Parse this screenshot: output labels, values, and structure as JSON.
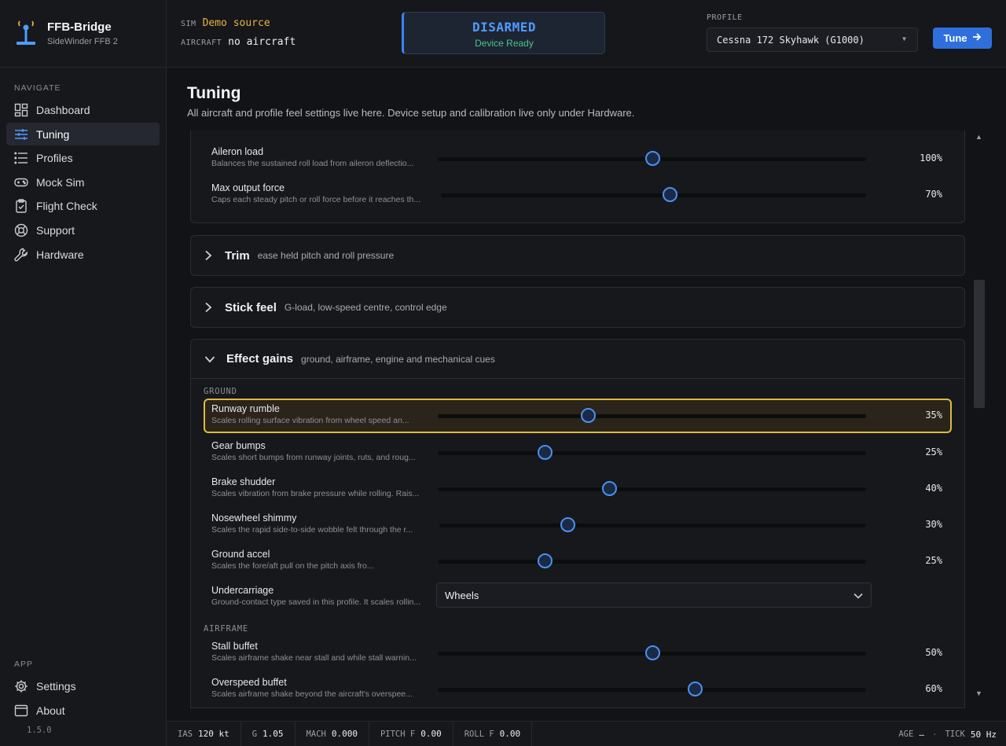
{
  "brand": {
    "title": "FFB-Bridge",
    "subtitle": "SideWinder FFB 2"
  },
  "nav": {
    "section_label": "NAVIGATE",
    "items": [
      {
        "label": "Dashboard",
        "icon": "dashboard-icon"
      },
      {
        "label": "Tuning",
        "icon": "sliders-icon",
        "active": true
      },
      {
        "label": "Profiles",
        "icon": "list-icon"
      },
      {
        "label": "Mock Sim",
        "icon": "gamepad-icon"
      },
      {
        "label": "Flight Check",
        "icon": "clipboard-check-icon"
      },
      {
        "label": "Support",
        "icon": "lifebuoy-icon"
      },
      {
        "label": "Hardware",
        "icon": "wrench-icon"
      }
    ],
    "app_label": "APP",
    "app_items": [
      {
        "label": "Settings",
        "icon": "gear-icon"
      },
      {
        "label": "About",
        "icon": "window-icon"
      }
    ],
    "version": "1.5.0"
  },
  "header": {
    "sim_key": "SIM",
    "sim_value": "Demo source",
    "aircraft_key": "AIRCRAFT",
    "aircraft_value": "no aircraft",
    "status_main": "DISARMED",
    "status_sub": "Device Ready",
    "profile_label": "PROFILE",
    "profile_value": "Cessna 172 Skyhawk (G1000)",
    "tune_label": "Tune"
  },
  "page": {
    "title": "Tuning",
    "subtitle": "All aircraft and profile feel settings live here. Device setup and calibration live only under Hardware."
  },
  "top_panel": {
    "rows": [
      {
        "title": "Aileron load",
        "desc": "Balances the sustained roll load from aileron deflectio...",
        "value": 100,
        "label": "100%"
      },
      {
        "title": "Max output force",
        "desc": "Caps each steady pitch or roll force before it reaches th...",
        "value": 70,
        "label": "70%"
      }
    ]
  },
  "trim": {
    "title": "Trim",
    "desc": "ease held pitch and roll pressure"
  },
  "stick_feel": {
    "title": "Stick feel",
    "desc": "G-load, low-speed centre, control edge"
  },
  "effect_gains": {
    "title": "Effect gains",
    "desc": "ground, airframe, engine and mechanical cues",
    "ground_label": "GROUND",
    "ground_rows": [
      {
        "title": "Runway rumble",
        "desc": "Scales rolling surface vibration from wheel speed an...",
        "value": 35,
        "label": "35%"
      },
      {
        "title": "Gear bumps",
        "desc": "Scales short bumps from runway joints, ruts, and roug...",
        "value": 25,
        "label": "25%"
      },
      {
        "title": "Brake shudder",
        "desc": "Scales vibration from brake pressure while rolling. Rais...",
        "value": 40,
        "label": "40%"
      },
      {
        "title": "Nosewheel shimmy",
        "desc": "Scales the rapid side-to-side wobble felt through the r...",
        "value": 30,
        "label": "30%"
      },
      {
        "title": "Ground accel",
        "desc": "Scales the fore/aft pull on the pitch axis fro...",
        "value": 25,
        "label": "25%"
      }
    ],
    "undercarriage": {
      "title": "Undercarriage",
      "desc": "Ground-contact type saved in this profile. It scales rollin...",
      "value": "Wheels"
    },
    "airframe_label": "AIRFRAME",
    "airframe_rows": [
      {
        "title": "Stall buffet",
        "desc": "Scales airframe shake near stall and while stall warnin...",
        "value": 50,
        "label": "50%"
      },
      {
        "title": "Overspeed buffet",
        "desc": "Scales airframe shake beyond the aircraft's overspee...",
        "value": 60,
        "label": "60%"
      }
    ]
  },
  "statusbar": {
    "ias_k": "IAS",
    "ias_v": "120 kt",
    "g_k": "G",
    "g_v": "1.05",
    "mach_k": "MACH",
    "mach_v": "0.000",
    "pitch_k": "PITCH F",
    "pitch_v": "0.00",
    "roll_k": "ROLL F",
    "roll_v": "0.00",
    "age_k": "AGE",
    "age_v": "—",
    "sep": "·",
    "tick_k": "TICK",
    "tick_v": "50 Hz"
  },
  "colors": {
    "accent": "#3b82f6",
    "highlight": "#e0b93f",
    "ready": "#4cc48a",
    "sim": "#e8b33f"
  }
}
